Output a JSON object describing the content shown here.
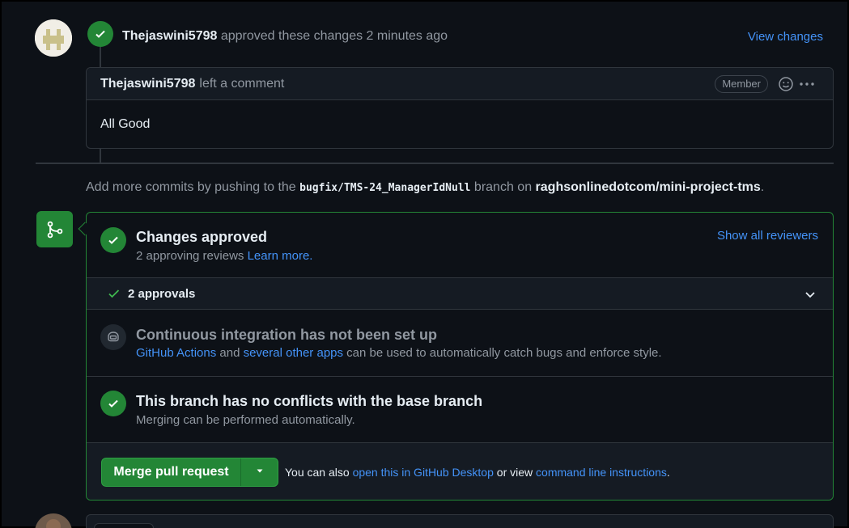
{
  "review_event": {
    "user": "Thejaswini5798",
    "action": "approved these changes",
    "time": "2 minutes ago",
    "view_changes_label": "View changes"
  },
  "comment": {
    "author": "Thejaswini5798",
    "action": "left a comment",
    "badge": "Member",
    "body": "All Good"
  },
  "push_hint": {
    "prefix": "Add more commits by pushing to the",
    "branch": "bugfix/TMS-24_ManagerIdNull",
    "middle": "branch on",
    "repo": "raghsonlinedotcom/mini-project-tms",
    "suffix": "."
  },
  "merge_box": {
    "approved": {
      "title": "Changes approved",
      "subtitle": "2 approving reviews",
      "learn_more": "Learn more.",
      "show_reviewers": "Show all reviewers"
    },
    "approvals": {
      "label": "2 approvals"
    },
    "ci": {
      "title": "Continuous integration has not been set up",
      "link1": "GitHub Actions",
      "and": "and",
      "link2": "several other apps",
      "rest": "can be used to automatically catch bugs and enforce style."
    },
    "conflicts": {
      "title": "This branch has no conflicts with the base branch",
      "subtitle": "Merging can be performed automatically."
    },
    "footer": {
      "merge_label": "Merge pull request",
      "text1": "You can also",
      "link1": "open this in GitHub Desktop",
      "text2": "or view",
      "link2": "command line instructions",
      "text3": "."
    }
  },
  "colors": {
    "background": "#0d1117",
    "accent_green": "#238636",
    "link_blue": "#4493f8",
    "muted_text": "#9198a1",
    "border": "#30363d"
  }
}
